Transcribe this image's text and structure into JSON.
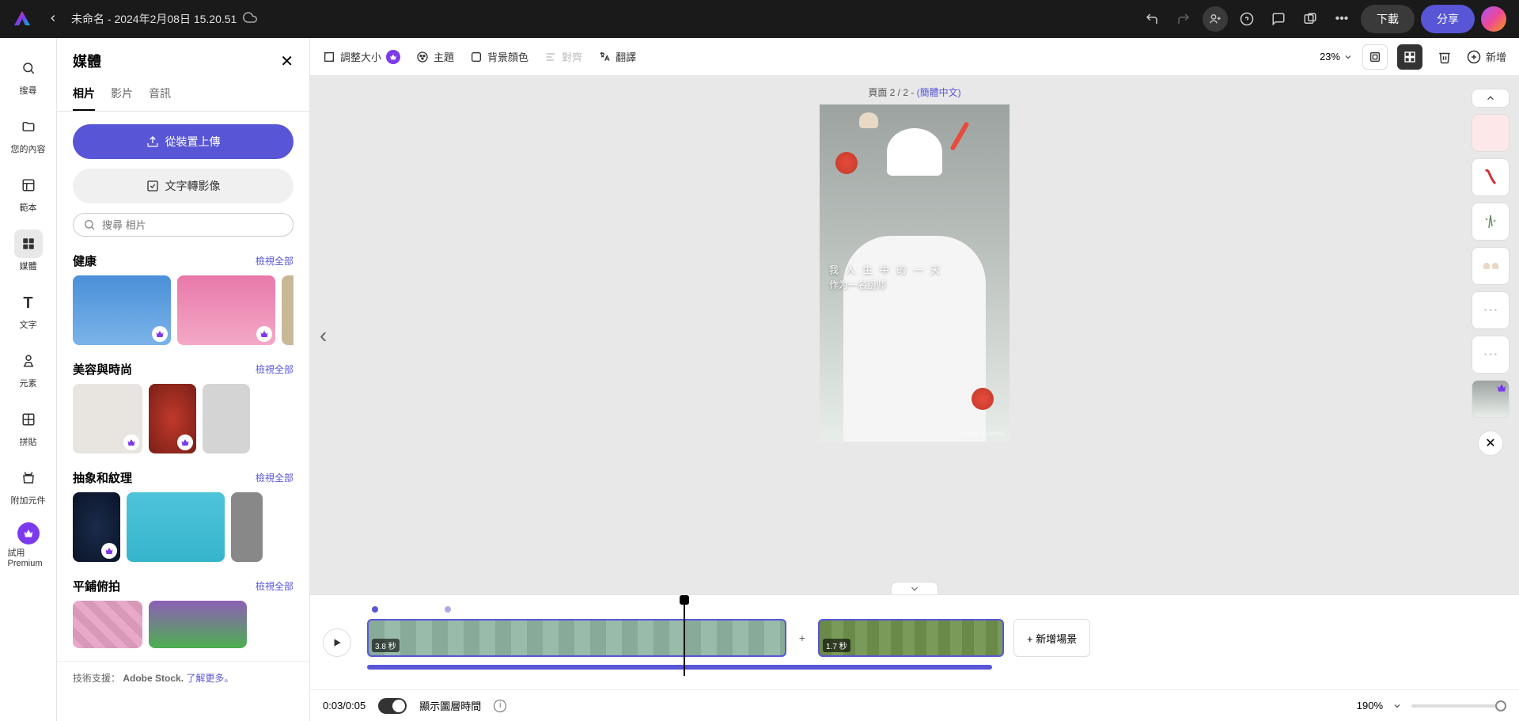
{
  "topbar": {
    "doc_title": "未命名 - 2024年2月08日 15.20.51",
    "download": "下載",
    "share": "分享"
  },
  "leftrail": {
    "search": "搜尋",
    "your_stuff": "您的內容",
    "templates": "範本",
    "media": "媒體",
    "text": "文字",
    "elements": "元素",
    "grids": "拼貼",
    "addons": "附加元件",
    "premium": "試用 Premium"
  },
  "mediapanel": {
    "title": "媒體",
    "tabs": {
      "photos": "相片",
      "videos": "影片",
      "audio": "音訊"
    },
    "upload": "從裝置上傳",
    "text2image": "文字轉影像",
    "search_placeholder": "搜尋 相片",
    "view_all": "檢視全部",
    "cat_health": "健康",
    "cat_beauty": "美容與時尚",
    "cat_abstract": "抽象和紋理",
    "cat_flatlay": "平鋪俯拍",
    "footer_prefix": "技術支援：",
    "footer_brand": "Adobe Stock.",
    "footer_link": "了解更多。"
  },
  "toolbar": {
    "resize": "調整大小",
    "theme": "主題",
    "bgcolor": "背景顔色",
    "align": "對齊",
    "translate": "翻譯",
    "zoom": "23%",
    "add": "新增"
  },
  "canvas": {
    "page_label_prefix": "頁面 2 / 2 - ",
    "page_label_link": "(簡體中文)",
    "text_line1": "我 人 生 中 的 一 天",
    "text_line2": "作为一名厨师",
    "watermark": "Adobe Express"
  },
  "timeline": {
    "clip1_dur": "3.8 秒",
    "clip2_dur": "1.7 秒",
    "add_scene": "+ 新增場景",
    "time": "0:03/0:05",
    "show_layers": "顯示圖層時間",
    "zoom": "190%"
  }
}
